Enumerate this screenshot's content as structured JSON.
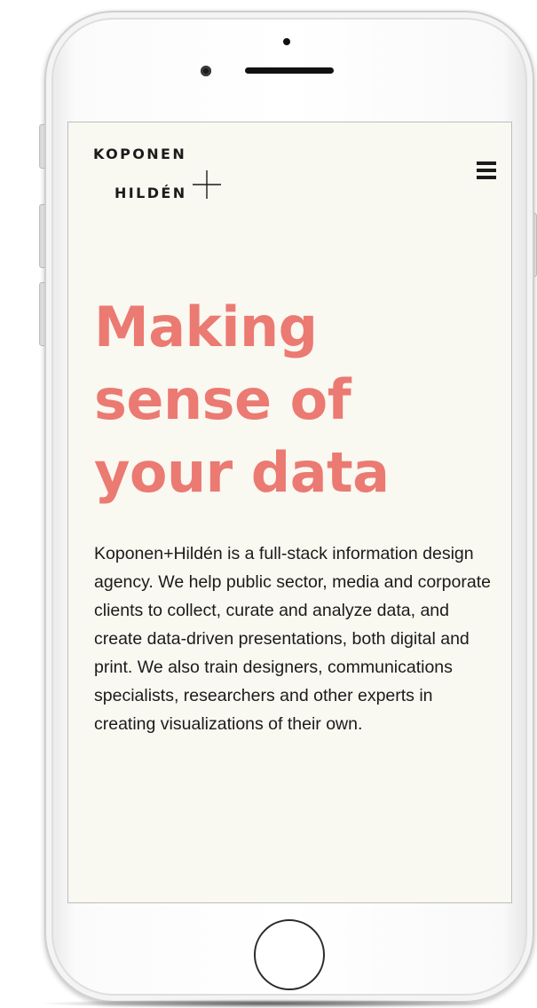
{
  "device": {
    "frame_color": "#ffffff"
  },
  "header": {
    "logo": {
      "line1": "KOPONEN",
      "line2": "HILDÉN",
      "plus_icon": "plus-icon"
    },
    "menu_icon": "hamburger-menu-icon"
  },
  "hero": {
    "headline_lines": [
      "Making",
      "sense of",
      "your data"
    ],
    "headline_color": "#eb7a72",
    "intro": "Koponen+Hildén is a full-stack information design agency. We help public sector, media and corporate clients to collect, curate and analyze data, and create data-driven presentations, both digital and print. We also train designers, communications specialists, researchers and other experts in creating visualizations of their own."
  },
  "colors": {
    "screen_background": "#f9f8f1",
    "text": "#1b1b1b",
    "accent": "#eb7a72"
  }
}
